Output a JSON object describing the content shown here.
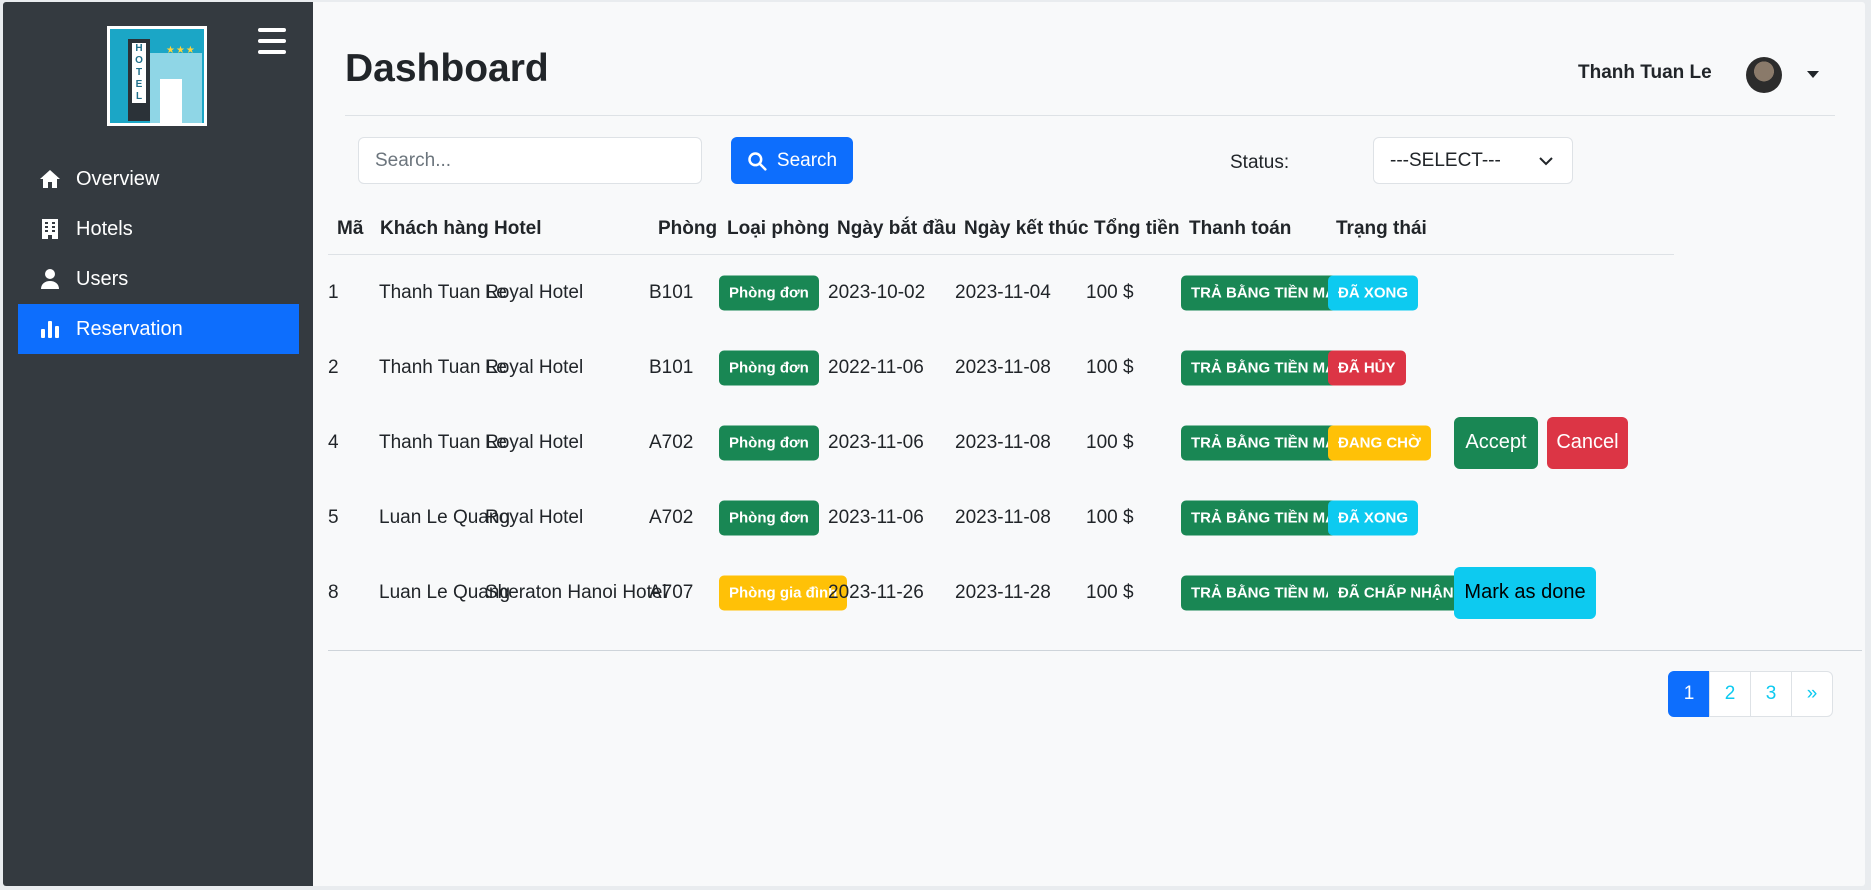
{
  "sidebar": {
    "logo_text": "HOTEL",
    "items": [
      {
        "label": "Overview",
        "icon": "home-icon",
        "active": false
      },
      {
        "label": "Hotels",
        "icon": "building-icon",
        "active": false
      },
      {
        "label": "Users",
        "icon": "user-icon",
        "active": false
      },
      {
        "label": "Reservation",
        "icon": "bar-chart-icon",
        "active": true
      }
    ]
  },
  "header": {
    "title": "Dashboard",
    "user_name": "Thanh Tuan Le"
  },
  "filters": {
    "search_placeholder": "Search...",
    "search_value": "",
    "search_button": "Search",
    "status_label": "Status:",
    "status_selected": "---SELECT---"
  },
  "table": {
    "columns": [
      "Mã",
      "Khách hàng",
      "Hotel",
      "Phòng",
      "Loại phòng",
      "Ngày bắt đầu",
      "Ngày kết thúc",
      "Tổng tiền",
      "Thanh toán",
      "Trạng thái"
    ],
    "rows": [
      {
        "id": "1",
        "customer": "Thanh Tuan Le",
        "hotel": "Royal Hotel",
        "room": "B101",
        "room_type": "Phòng đơn",
        "start": "2023-10-02",
        "end": "2023-11-04",
        "total": "100 $",
        "payment": "TRẢ BẰNG TIỀN MẶT",
        "status": "ĐÃ XONG"
      },
      {
        "id": "2",
        "customer": "Thanh Tuan Le",
        "hotel": "Royal Hotel",
        "room": "B101",
        "room_type": "Phòng đơn",
        "start": "2022-11-06",
        "end": "2023-11-08",
        "total": "100 $",
        "payment": "TRẢ BẰNG TIỀN MẶT",
        "status": "ĐÃ HỦY"
      },
      {
        "id": "4",
        "customer": "Thanh Tuan Le",
        "hotel": "Royal Hotel",
        "room": "A702",
        "room_type": "Phòng đơn",
        "start": "2023-11-06",
        "end": "2023-11-08",
        "total": "100 $",
        "payment": "TRẢ BẰNG TIỀN MẶT",
        "status": "ĐANG CHỜ",
        "actions": [
          "Accept",
          "Cancel"
        ]
      },
      {
        "id": "5",
        "customer": "Luan Le Quang",
        "hotel": "Royal Hotel",
        "room": "A702",
        "room_type": "Phòng đơn",
        "start": "2023-11-06",
        "end": "2023-11-08",
        "total": "100 $",
        "payment": "TRẢ BẰNG TIỀN MẶT",
        "status": "ĐÃ XONG"
      },
      {
        "id": "8",
        "customer": "Luan Le Quang",
        "hotel": "Sheraton Hanoi Hotel",
        "room": "A707",
        "room_type": "Phòng gia đình",
        "start": "2023-11-26",
        "end": "2023-11-28",
        "total": "100 $",
        "payment": "TRẢ BẰNG TIỀN MẶT",
        "status": "ĐÃ CHẤP NHẬN",
        "actions": [
          "Mark as done"
        ]
      }
    ]
  },
  "pagination": {
    "pages": [
      "1",
      "2",
      "3"
    ],
    "next": "»",
    "current": "1"
  },
  "colors": {
    "sidebar_bg": "#343a40",
    "primary": "#0d6efd",
    "success": "#198754",
    "danger": "#dc3545",
    "warning": "#ffc107",
    "info": "#0dcaf0"
  }
}
